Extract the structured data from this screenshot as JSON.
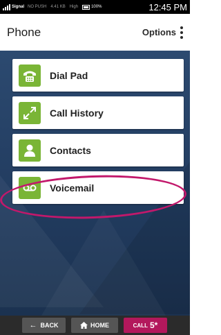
{
  "status_bar": {
    "signal": "Signal",
    "no_sim": "NO PUSH",
    "speed": "4.41 KB",
    "data": "High",
    "battery": "100%",
    "time": "12:45 PM"
  },
  "header": {
    "title": "Phone",
    "options_label": "Options"
  },
  "menu": {
    "items": [
      {
        "label": "Dial Pad",
        "icon": "phone-icon"
      },
      {
        "label": "Call History",
        "icon": "call-history-icon"
      },
      {
        "label": "Contacts",
        "icon": "contact-icon",
        "highlighted": true
      },
      {
        "label": "Voicemail",
        "icon": "voicemail-icon"
      }
    ]
  },
  "bottom_nav": {
    "back_label": "BACK",
    "home_label": "HOME",
    "call_label": "CALL",
    "call_number": "5*"
  },
  "colors": {
    "accent_green": "#7ab536",
    "background_blue": "#2c4a70",
    "highlight_magenta": "#c2186b",
    "call_button": "#b3185c"
  }
}
